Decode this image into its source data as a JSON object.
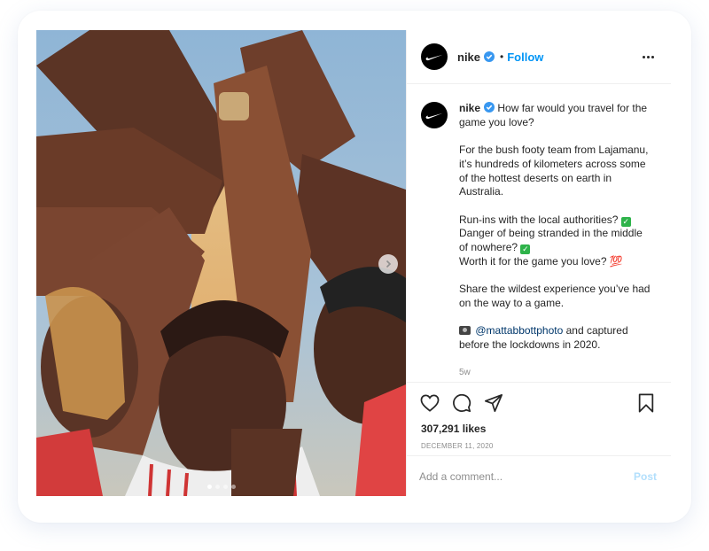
{
  "post": {
    "username": "nike",
    "follow_label": "Follow",
    "separator": "•",
    "caption": {
      "username": "nike",
      "line1": " How far would you travel for the game you love?",
      "para2": "For the bush footy team from Lajamanu, it’s hundreds of kilometers across some of the hottest deserts on earth in Australia.",
      "runins": "Run-ins with the local authorities? ",
      "danger": "Danger of being stranded in the middle of nowhere? ",
      "worth": "Worth it for the game you love? ",
      "share": "Share the wildest experience you’ve had on the way to a game.",
      "mention": "@mattabbottphoto",
      "credit_rest": " and captured before the lockdowns in 2020.",
      "check_emoji": "✓",
      "heart_emoji": "💯"
    },
    "time_ago": "5w",
    "likes_label": "307,291 likes",
    "date_label": "DECEMBER 11, 2020",
    "comment_placeholder": "Add a comment...",
    "post_button_label": "Post"
  },
  "icons": [
    "nike-logo-icon",
    "verified-icon",
    "more-options-icon",
    "heart-icon",
    "comment-icon",
    "share-icon",
    "bookmark-icon",
    "chevron-right-icon",
    "camera-emoji-icon"
  ],
  "colors": {
    "follow": "#0095f6",
    "verified": "#3897f0",
    "post_button_disabled": "#b2dffc",
    "muted_text": "#8e8e8e"
  },
  "carousel": {
    "total": 4,
    "active_index": 0
  }
}
